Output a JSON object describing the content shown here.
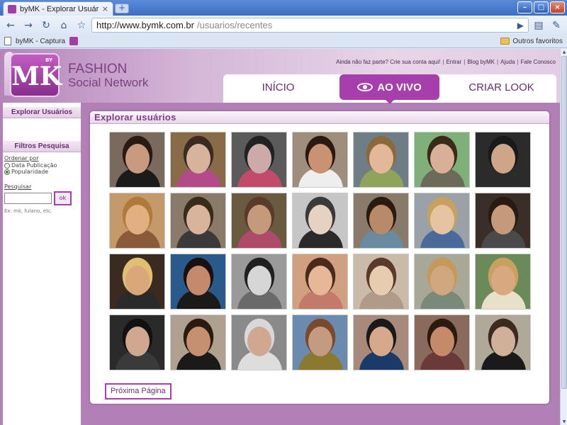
{
  "browser": {
    "tab_title": "byMK - Explorar Usuários",
    "tab_close": "×",
    "new_tab": "+",
    "address_host": "http://www.bymk.com.br",
    "address_path": "/usuarios/recentes",
    "bookmark_1": "byMK - Captura",
    "bookmark_other": "Outros favoritos"
  },
  "site": {
    "logo_text": "MK",
    "logo_by": "BY",
    "brand_line1": "FASHION",
    "brand_line2": "Social Network",
    "top_links": [
      "Ainda não faz parte? Crie sua conta aqui!",
      "Entrar",
      "Blog byMK",
      "Ajuda",
      "Fale Conosco"
    ],
    "nav": {
      "home": "INÍCIO",
      "live": "AO VIVO",
      "create": "CRIAR LOOK"
    }
  },
  "sidebar": {
    "explore_title": "Explorar Usuários",
    "filters_title": "Filtros Pesquisa",
    "order_label": "Ordenar por",
    "order_options": [
      "Data Publicação",
      "Popularidade"
    ],
    "order_selected": "Popularidade",
    "search_label": "Pesquisar",
    "search_value": "",
    "ok_label": "ok",
    "hint": "Ex: mk, fulano, etc."
  },
  "main": {
    "title": "Explorar usuários",
    "next_label": "Próxima Página",
    "photos": [
      {
        "bg": "#7a6a5e",
        "face": "#c99a7f",
        "hair": "#2a1a14",
        "body": "#1b1b1b"
      },
      {
        "bg": "#8a6b48",
        "face": "#d6b39a",
        "hair": "#3b2a22",
        "body": "#b44a8a"
      },
      {
        "bg": "#5b5b5b",
        "face": "#caa",
        "hair": "#222",
        "body": "#c24a6a"
      },
      {
        "bg": "#a08e7c",
        "face": "#c99272",
        "hair": "#2b1a12",
        "body": "#eeeeee"
      },
      {
        "bg": "#6f7e86",
        "face": "#e2b898",
        "hair": "#8a6a3a",
        "body": "#8fa45a"
      },
      {
        "bg": "#7fb07a",
        "face": "#d8b097",
        "hair": "#3a2a1a",
        "body": "#6d6a5a"
      },
      {
        "bg": "#2b2b2b",
        "face": "#cfa58a",
        "hair": "#1a1a1a",
        "body": "#2b2b2b"
      },
      {
        "bg": "#c49a6a",
        "face": "#e0b080",
        "hair": "#b07a3a",
        "body": "#8a5a3a"
      },
      {
        "bg": "#8a7a6a",
        "face": "#d8b49a",
        "hair": "#3a2a1a",
        "body": "#3a3a3a"
      },
      {
        "bg": "#6a5a40",
        "face": "#c49a7a",
        "hair": "#5a3a2a",
        "body": "#b04a6a"
      },
      {
        "bg": "#c6c6c6",
        "face": "#e6d2c2",
        "hair": "#3a3a3a",
        "body": "#2a2a2a"
      },
      {
        "bg": "#8a7a6a",
        "face": "#b88a6a",
        "hair": "#2a1a10",
        "body": "#6a8aa0"
      },
      {
        "bg": "#9aa2a8",
        "face": "#e6c4a2",
        "hair": "#c8a060",
        "body": "#4a6a9a"
      },
      {
        "bg": "#3a2e28",
        "face": "#c49a7a",
        "hair": "#2a1a14",
        "body": "#4a4a4a"
      },
      {
        "bg": "#3a2a20",
        "face": "#d8a87a",
        "hair": "#e0c070",
        "body": "#2a2a2a"
      },
      {
        "bg": "#2a5a8a",
        "face": "#c48a6a",
        "hair": "#1a1010",
        "body": "#1a1a1a"
      },
      {
        "bg": "#9a9a9a",
        "face": "#d6d6d6",
        "hair": "#202020",
        "body": "#6a6a6a"
      },
      {
        "bg": "#d0a080",
        "face": "#e6b898",
        "hair": "#4a2a1a",
        "body": "#c47a6a"
      },
      {
        "bg": "#cabaa8",
        "face": "#e8ccb0",
        "hair": "#5a3a2a",
        "body": "#b09a88"
      },
      {
        "bg": "#a8a898",
        "face": "#d0a880",
        "hair": "#c89858",
        "body": "#7a8a7a"
      },
      {
        "bg": "#6a8a5a",
        "face": "#d8a880",
        "hair": "#c8a060",
        "body": "#e8e0c8"
      },
      {
        "bg": "#2a2a2a",
        "face": "#d0a890",
        "hair": "#111111",
        "body": "#3a3a3a"
      },
      {
        "bg": "#b0a090",
        "face": "#c49070",
        "hair": "#2a1a10",
        "body": "#1a1a1a"
      },
      {
        "bg": "#8a8a8a",
        "face": "#d0a890",
        "hair": "#d8d8d8",
        "body": "#dddddd"
      },
      {
        "bg": "#6a8ab0",
        "face": "#c49a80",
        "hair": "#7a4a2a",
        "body": "#8a7a30"
      },
      {
        "bg": "#a88a7a",
        "face": "#d8a88a",
        "hair": "#1a1a1a",
        "body": "#1a3a6a"
      },
      {
        "bg": "#8a6a5a",
        "face": "#c48a6a",
        "hair": "#2a1a10",
        "body": "#6a3a3a"
      },
      {
        "bg": "#b0a898",
        "face": "#d0b098",
        "hair": "#3a2a20",
        "body": "#1a1a1a"
      }
    ]
  }
}
